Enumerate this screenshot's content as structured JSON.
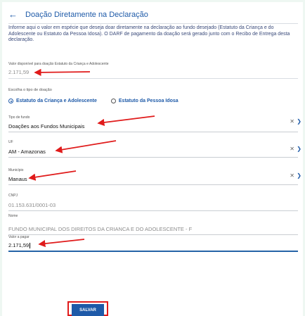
{
  "header": {
    "title": "Doação Diretamente na Declaração",
    "back_icon": "arrow-left-icon"
  },
  "intro_text": "Informe aqui o valor em espécie que deseja doar diretamente na declaração ao fundo desejado (Estatuto da Criança e do Adolescente ou Estatuto da Pessoa Idosa). O DARF de pagamento da doação será gerado junto com o Recibo de Entrega desta declaração.",
  "available": {
    "label": "Valor disponível para doação Estatuto da Criança e Adolescente",
    "value": "2.171,59"
  },
  "donation_type": {
    "label": "Escolha o tipo de doação",
    "options": [
      "Estatuto da Criança e Adolescente",
      "Estatuto da Pessoa Idosa"
    ],
    "selected": "Estatuto da Criança e Adolescente"
  },
  "fund_type": {
    "label": "Tipo de fundo",
    "value": "Doações aos Fundos Municipais"
  },
  "uf": {
    "label": "UF",
    "value": "AM - Amazonas"
  },
  "municipio": {
    "label": "Município",
    "value": "Manaus"
  },
  "cnpj": {
    "label": "CNPJ",
    "value": "01.153.631/0001-03"
  },
  "nome": {
    "label": "Nome",
    "value": "FUNDO MUNICIPAL DOS DIREITOS DA CRIANCA E DO ADOLESCENTE - F"
  },
  "valor_pagar": {
    "label": "Valor a pagar",
    "value": "2.171,59"
  },
  "save_label": "SALVAR",
  "colors": {
    "accent": "#1e5aa8",
    "annotation": "#e01b1b"
  }
}
